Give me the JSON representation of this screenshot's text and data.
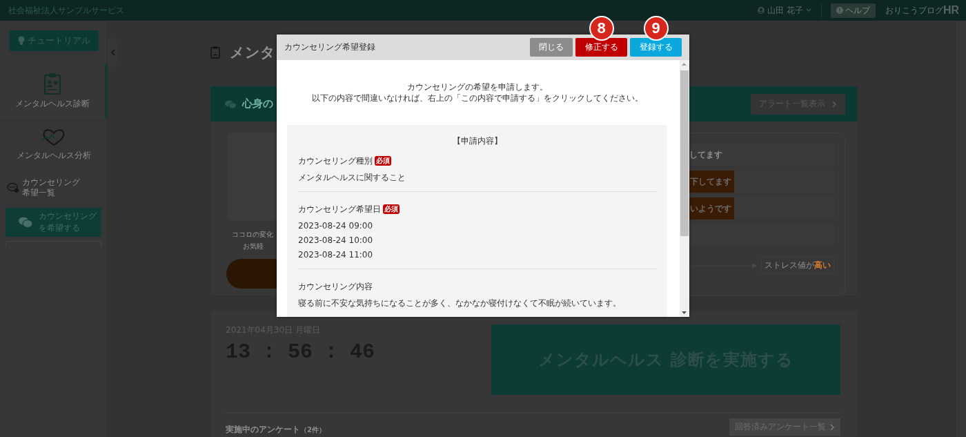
{
  "header": {
    "org_name": "社会福祉法人サンプルサービス",
    "user_name": "山田 花子",
    "help_label": "ヘルプ",
    "blog_label": "おりこうブログ",
    "logo_text": "HR"
  },
  "sidebar": {
    "tutorial_label": "チュートリアル",
    "items": [
      {
        "label": "メンタルヘルス診断",
        "kind": "stacked",
        "selected": true
      },
      {
        "label": "メンタルヘルス分析",
        "kind": "stacked",
        "selected": false
      },
      {
        "label": "カウンセリング希望一覧",
        "kind": "inline",
        "selected": false
      }
    ],
    "cta_label": "カウンセリングを希望する"
  },
  "page": {
    "title": "メンタ",
    "alert_card": {
      "title": "心身の",
      "list_button": "アラート一覧表示",
      "caption_lines": [
        "ココロの変化",
        "お気軽"
      ],
      "rows": [
        {
          "kind": "plain",
          "text": "してます"
        },
        {
          "kind": "badge",
          "text": "下してます"
        },
        {
          "kind": "badge",
          "text": "いようです"
        },
        {
          "kind": "empty"
        }
      ],
      "stress_label": "ストレス値が**高い**"
    },
    "clock_card": {
      "date": "2021年04月30日 月曜日",
      "time": "13 : 56 : 46",
      "cta": "メンタルヘルス 診断を実施する",
      "survey_title": "実施中のアンケート",
      "survey_count": "（2件）",
      "answered_button": "回答済みアンケート一覧"
    }
  },
  "modal": {
    "title": "カウンセリング希望登録",
    "buttons": [
      {
        "label": "閉じる",
        "kind": "close"
      },
      {
        "label": "修正する",
        "kind": "edit",
        "marker": "8"
      },
      {
        "label": "登録する",
        "kind": "submit",
        "marker": "9"
      }
    ],
    "intro_lines": [
      "カウンセリングの希望を申請します。",
      "以下の内容で間違いなければ、右上の「この内容で申請する」をクリックしてください。"
    ],
    "section_title": "【申請内容】",
    "fields": [
      {
        "label": "カウンセリング種別",
        "badge": "必須",
        "values": [
          "メンタルヘルスに関すること"
        ]
      },
      {
        "label": "カウンセリング希望日",
        "badge": "必須",
        "values": [
          "2023-08-24 09:00",
          "2023-08-24 10:00",
          "2023-08-24 11:00"
        ]
      },
      {
        "label": "カウンセリング内容",
        "values": [
          "寝る前に不安な気持ちになることが多く、なかなか寝付けなくて不眠が続いています。"
        ]
      }
    ]
  }
}
